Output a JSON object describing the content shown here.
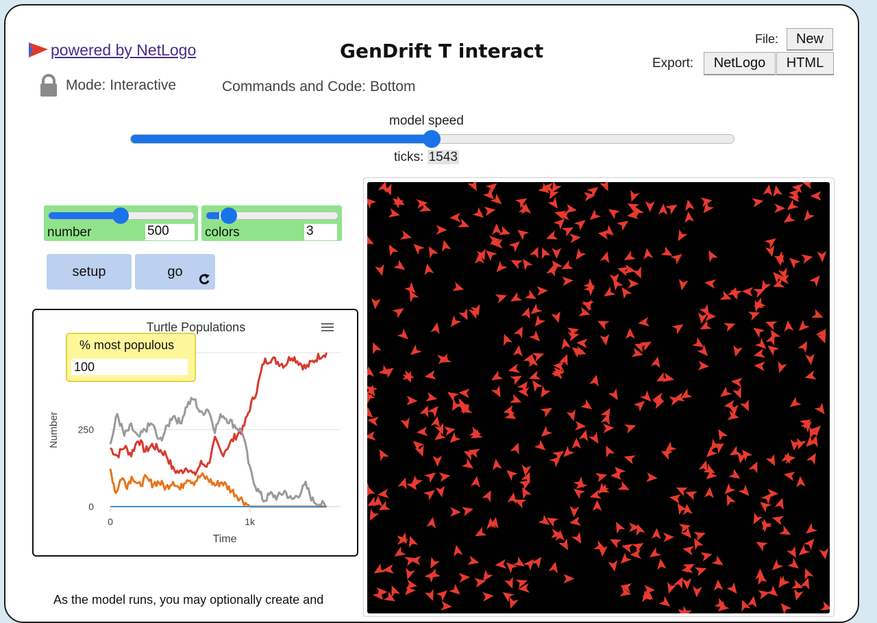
{
  "header": {
    "powered_label": "powered by NetLogo",
    "model_title": "GenDrift T interact",
    "file_label": "File:",
    "new_button": "New",
    "export_label": "Export:",
    "netlogo_button": "NetLogo",
    "html_button": "HTML"
  },
  "mode": {
    "label": "Mode: Interactive",
    "commands_label": "Commands and Code: Bottom"
  },
  "speed": {
    "label": "model speed",
    "level": 0.5,
    "ticks_label": "ticks:",
    "ticks_value": "1543"
  },
  "sliders": {
    "number": {
      "label": "number",
      "value": "500",
      "level": 0.5
    },
    "colors": {
      "label": "colors",
      "value": "3",
      "level": 0.08
    }
  },
  "buttons": {
    "setup": "setup",
    "go": "go",
    "go_icon": "forever-icon"
  },
  "monitor": {
    "label": "% most populous",
    "value": "100"
  },
  "plot": {
    "menu_icon": "hamburger-menu-icon"
  },
  "colors": {
    "red": "#d73b2e",
    "gray": "#9a9a9a",
    "orange": "#e8741a",
    "blue": "#3a8fd6",
    "turtle": "#e83a30"
  },
  "chart_data": {
    "type": "line",
    "title": "Turtle Populations",
    "xlabel": "Time",
    "ylabel": "Number",
    "xlim": [
      0,
      1650
    ],
    "ylim": [
      0,
      500
    ],
    "x_ticks": [
      {
        "value": 0,
        "label": "0"
      },
      {
        "value": 1000,
        "label": "1k"
      }
    ],
    "y_ticks": [
      {
        "value": 0,
        "label": "0"
      },
      {
        "value": 250,
        "label": "250"
      }
    ],
    "grid": true,
    "series": [
      {
        "color": "red",
        "x": [
          0,
          50,
          100,
          150,
          200,
          250,
          300,
          350,
          400,
          450,
          500,
          550,
          600,
          650,
          700,
          750,
          800,
          850,
          900,
          950,
          1000,
          1050,
          1100,
          1150,
          1200,
          1250,
          1300,
          1350,
          1400,
          1450,
          1500,
          1550
        ],
        "y": [
          190,
          165,
          195,
          170,
          220,
          180,
          200,
          185,
          170,
          120,
          110,
          130,
          100,
          140,
          135,
          215,
          170,
          200,
          230,
          250,
          320,
          380,
          470,
          480,
          470,
          460,
          490,
          470,
          450,
          470,
          490,
          500
        ]
      },
      {
        "color": "gray",
        "x": [
          0,
          50,
          100,
          150,
          200,
          250,
          300,
          350,
          400,
          450,
          500,
          550,
          600,
          650,
          700,
          750,
          800,
          850,
          900,
          950,
          1000,
          1050,
          1100,
          1150,
          1200,
          1250,
          1300,
          1350,
          1400,
          1450,
          1500,
          1550
        ],
        "y": [
          200,
          300,
          230,
          260,
          220,
          250,
          270,
          210,
          250,
          300,
          270,
          330,
          350,
          300,
          320,
          250,
          300,
          280,
          260,
          240,
          120,
          60,
          20,
          40,
          30,
          50,
          20,
          40,
          70,
          20,
          10,
          0
        ]
      },
      {
        "color": "orange",
        "x": [
          0,
          40,
          80,
          120,
          160,
          200,
          250,
          300,
          350,
          400,
          450,
          500,
          550,
          600,
          650,
          700,
          750,
          800,
          850,
          900,
          950,
          1000,
          1050,
          1100,
          1150,
          1200,
          1250,
          1300,
          1350,
          1400,
          1450,
          1500,
          1550
        ],
        "y": [
          120,
          45,
          95,
          70,
          100,
          65,
          90,
          75,
          80,
          60,
          85,
          55,
          95,
          80,
          100,
          90,
          70,
          80,
          60,
          40,
          20,
          0,
          0,
          0,
          0,
          0,
          0,
          0,
          0,
          0,
          0,
          0,
          0
        ]
      },
      {
        "color": "blue",
        "x": [
          0,
          1550
        ],
        "y": [
          0,
          0
        ]
      }
    ]
  },
  "info_text": "As the model runs, you may optionally create and"
}
